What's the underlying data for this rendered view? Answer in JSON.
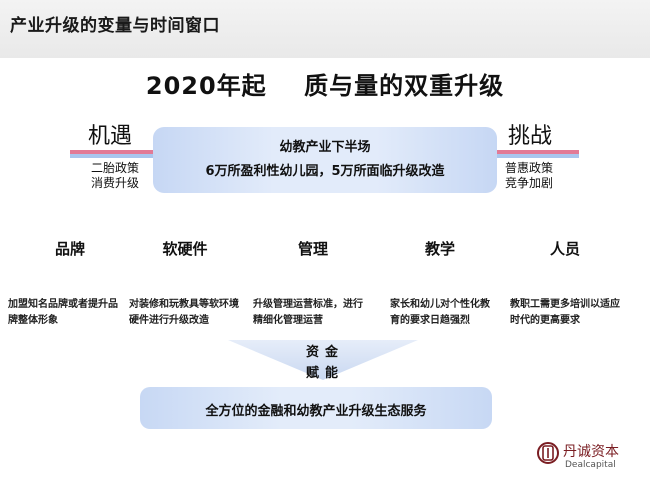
{
  "header": {
    "title": "产业升级的变量与时间窗口"
  },
  "main_title": "2020年起    质与量的双重升级",
  "center": {
    "line1": "幼教产业下半场",
    "line2": "6万所盈利性幼儿园，5万所面临升级改造"
  },
  "left": {
    "title": "机遇",
    "items": [
      "二胎政策",
      "消费升级"
    ]
  },
  "right": {
    "title": "挑战",
    "items": [
      "普惠政策",
      "竞争加剧"
    ]
  },
  "columns": [
    {
      "heading": "品牌",
      "desc": "加盟知名品牌或者提升品牌整体形象"
    },
    {
      "heading": "软硬件",
      "desc": "对装修和玩教具等软环境硬件进行升级改造"
    },
    {
      "heading": "管理",
      "desc": "升级管理运营标准，进行精细化管理运营"
    },
    {
      "heading": "教学",
      "desc": "家长和幼儿对个性化教育的要求日趋强烈"
    },
    {
      "heading": "人员",
      "desc": "教职工需更多培训以适应时代的更高要求"
    }
  ],
  "arrow": {
    "line1": "资金",
    "line2": "赋能"
  },
  "bottom": {
    "text": "全方位的金融和幼教产业升级生态服务"
  },
  "logo": {
    "cn": "丹诚资本",
    "en": "Dealcapital",
    "brand_color": "#7a1d22"
  },
  "colors": {
    "accent_pink": "#e27a96",
    "accent_blue": "#a9c6ee",
    "box_blue": "#c6d7f4"
  }
}
